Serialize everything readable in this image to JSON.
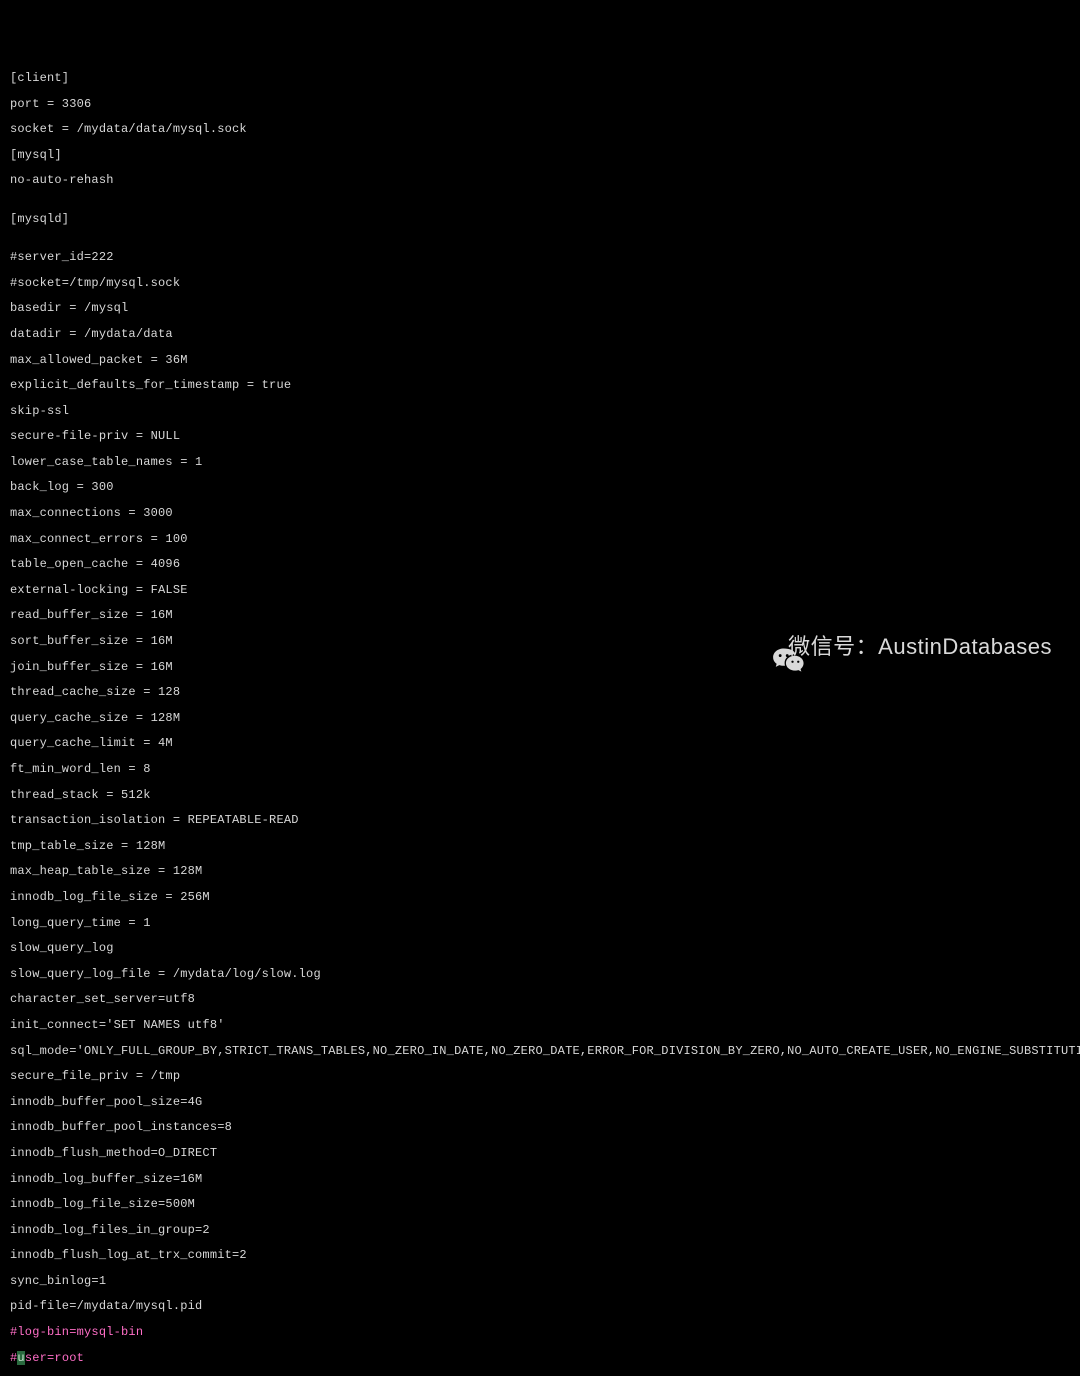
{
  "config_lines": [
    "[client]",
    "port = 3306",
    "socket = /mydata/data/mysql.sock",
    "[mysql]",
    "no-auto-rehash",
    "",
    "[mysqld]",
    "",
    "#server_id=222",
    "#socket=/tmp/mysql.sock",
    "basedir = /mysql",
    "datadir = /mydata/data",
    "max_allowed_packet = 36M",
    "explicit_defaults_for_timestamp = true",
    "skip-ssl",
    "secure-file-priv = NULL",
    "lower_case_table_names = 1",
    "back_log = 300",
    "max_connections = 3000",
    "max_connect_errors = 100",
    "table_open_cache = 4096",
    "external-locking = FALSE",
    "read_buffer_size = 16M",
    "sort_buffer_size = 16M",
    "join_buffer_size = 16M",
    "thread_cache_size = 128",
    "query_cache_size = 128M",
    "query_cache_limit = 4M",
    "ft_min_word_len = 8",
    "thread_stack = 512k",
    "transaction_isolation = REPEATABLE-READ",
    "tmp_table_size = 128M",
    "max_heap_table_size = 128M",
    "innodb_log_file_size = 256M",
    "long_query_time = 1",
    "slow_query_log",
    "slow_query_log_file = /mydata/log/slow.log",
    "character_set_server=utf8",
    "init_connect='SET NAMES utf8'",
    "sql_mode='ONLY_FULL_GROUP_BY,STRICT_TRANS_TABLES,NO_ZERO_IN_DATE,NO_ZERO_DATE,ERROR_FOR_DIVISION_BY_ZERO,NO_AUTO_CREATE_USER,NO_ENGINE_SUBSTITUTION,PIPES_AS_CONCAT,ANSI_QUOTES'",
    "secure_file_priv = /tmp",
    "innodb_buffer_pool_size=4G",
    "innodb_buffer_pool_instances=8",
    "innodb_flush_method=O_DIRECT",
    "innodb_log_buffer_size=16M",
    "innodb_log_file_size=500M",
    "innodb_log_files_in_group=2",
    "innodb_flush_log_at_trx_commit=2",
    "sync_binlog=1",
    "pid-file=/mydata/mysql.pid"
  ],
  "pink_line": "#log-bin=mysql-bin",
  "last_line_prefix": "#",
  "last_line_selected_char": "u",
  "last_line_rest": "ser=root",
  "watermark": {
    "label": "微信号：AustinDatabases"
  }
}
